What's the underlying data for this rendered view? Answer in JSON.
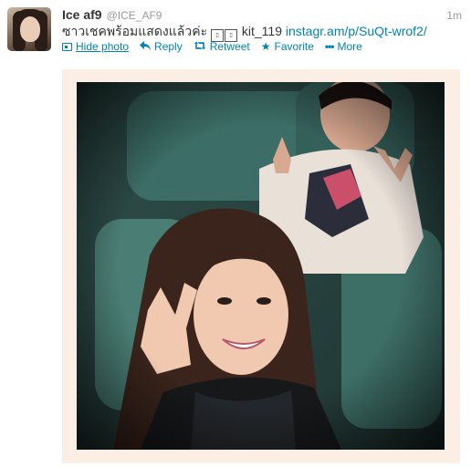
{
  "tweet": {
    "author_name": "Ice af9",
    "author_handle": "@ICE_AF9",
    "time": "1m",
    "text_prefix": "ซาวเชคพร้อมแสดงแล้วค่ะ",
    "mention_text": "kit_119",
    "link_text": "instagr.am/p/SuQt-wrof2/"
  },
  "actions": {
    "hide_photo": "Hide photo",
    "reply": "Reply",
    "retweet": "Retweet",
    "favorite": "Favorite",
    "more": "More"
  },
  "icons": {
    "photo": "photo-icon",
    "reply": "reply-arrow-icon",
    "retweet": "retweet-icon",
    "favorite": "star-icon",
    "more": "dots-icon"
  },
  "colors": {
    "link": "#0084b4",
    "name": "#333333",
    "muted": "#999999",
    "media_frame": "#fbeee4"
  }
}
